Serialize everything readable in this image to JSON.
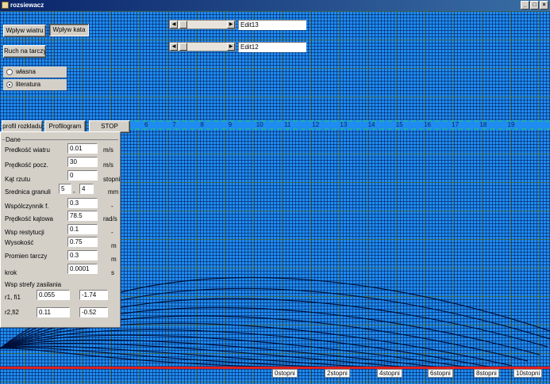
{
  "window": {
    "title": "rozsiewacz"
  },
  "top_buttons": {
    "wind": "Wpływ wiatru",
    "angle": "Wpływ kata",
    "disc": "Ruch na tarczy"
  },
  "radio": {
    "own": "własna",
    "literature": "literatura",
    "selected": "literatura"
  },
  "edits": {
    "edit13": "Edit13",
    "edit12": "Edit12"
  },
  "mid_buttons": {
    "profile": "profil rozkladu",
    "profilogram": "Profilogram",
    "stop": "STOP"
  },
  "scale_ticks": [
    "6",
    "7",
    "8",
    "9",
    "10",
    "11",
    "12",
    "13",
    "14",
    "15",
    "16",
    "17",
    "18",
    "19"
  ],
  "panel": {
    "group_title": "Dane",
    "fields": [
      {
        "label": "Predkość wiatru",
        "value": "0.01",
        "unit": "m/s"
      },
      {
        "label": "Prędkość pocz.",
        "value": "30",
        "unit": "m/s"
      },
      {
        "label": "Kąt rzutu",
        "value": "0",
        "unit": "stopni"
      },
      {
        "label": "Wspólczynnik f.",
        "value": "0.3",
        "unit": "-"
      },
      {
        "label": "Prędkość kątowa",
        "value": "78.5",
        "unit": "rad/s"
      },
      {
        "label": "Wsp restytucji",
        "value": "0.1",
        "unit": "-"
      },
      {
        "label": "Wysokość",
        "value": "0.75",
        "unit": "m"
      },
      {
        "label": "Promien tarczy",
        "value": "0.3",
        "unit": "m"
      },
      {
        "label": "krok",
        "value": "0.0001",
        "unit": "s"
      }
    ],
    "granule": {
      "label": "Srednica granuli",
      "min": "5",
      "sep": "-",
      "max": "4",
      "unit": "mm"
    },
    "zone_title": "Wsp strefy zasilania",
    "zone_rows": [
      {
        "label": "r1, fi1",
        "r": "0.055",
        "fi": "-1.74"
      },
      {
        "label": "r2,fi2",
        "r": "0.11",
        "fi": "-0.52"
      }
    ]
  },
  "angle_labels": [
    "0stopni",
    "2stopni",
    "4stopni",
    "6stopni",
    "8stopni",
    "10stopni"
  ],
  "colors": {
    "canvas": "#1e8cf0",
    "floor": "#e02020",
    "trajectory": "#00103a"
  }
}
